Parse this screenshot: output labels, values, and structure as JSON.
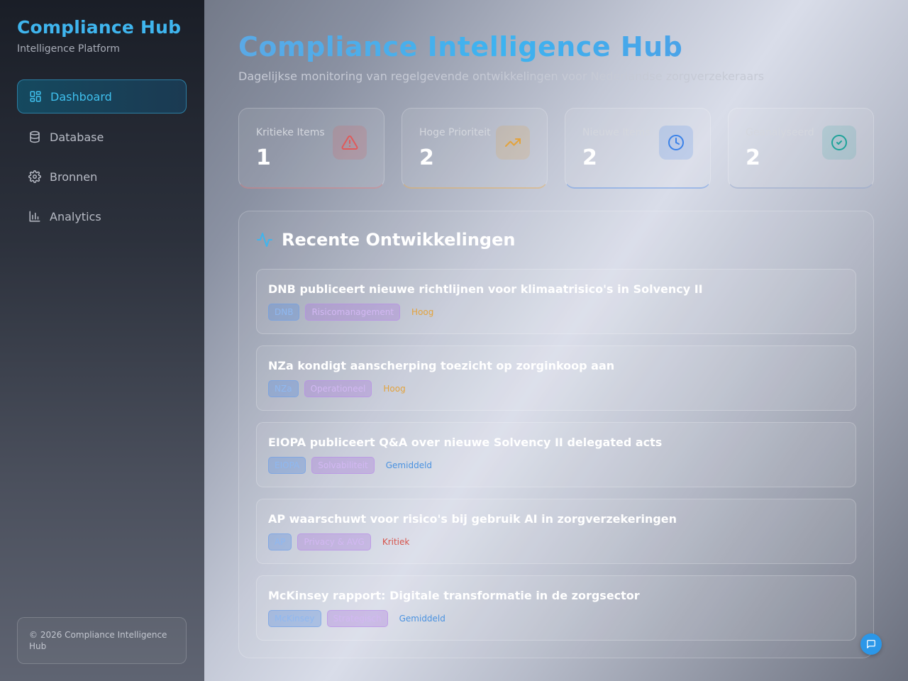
{
  "sidebar": {
    "brand_title": "Compliance Hub",
    "brand_subtitle": "Intelligence Platform",
    "items": [
      {
        "label": "Dashboard",
        "icon": "dashboard-icon",
        "active": true
      },
      {
        "label": "Database",
        "icon": "database-icon",
        "active": false
      },
      {
        "label": "Bronnen",
        "icon": "gear-icon",
        "active": false
      },
      {
        "label": "Analytics",
        "icon": "bar-chart-icon",
        "active": false
      }
    ],
    "footer": "© 2026 Compliance Intelligence Hub"
  },
  "header": {
    "title": "Compliance Intelligence Hub",
    "subtitle": "Dagelijkse monitoring van regelgevende ontwikkelingen voor Nederlandse zorgverzekeraars"
  },
  "stats": [
    {
      "label": "Kritieke Items",
      "value": "1",
      "icon": "alert-triangle-icon",
      "color": "#e05a5a"
    },
    {
      "label": "Hoge Prioriteit",
      "value": "2",
      "icon": "trending-up-icon",
      "color": "#e3a33d"
    },
    {
      "label": "Nieuwe Items",
      "value": "2",
      "icon": "clock-icon",
      "color": "#3b82e8"
    },
    {
      "label": "Geanalyseerd",
      "value": "2",
      "icon": "check-circle-icon",
      "color": "#1fa39a"
    }
  ],
  "recent": {
    "title": "Recente Ontwikkelingen",
    "icon": "activity-icon",
    "items": [
      {
        "title": "DNB publiceert nieuwe richtlijnen voor klimaatrisico's in Solvency II",
        "source": "DNB",
        "category": "Risicomanagement",
        "priority": "Hoog"
      },
      {
        "title": "NZa kondigt aanscherping toezicht op zorginkoop aan",
        "source": "NZa",
        "category": "Operationeel",
        "priority": "Hoog"
      },
      {
        "title": "EIOPA publiceert Q&A over nieuwe Solvency II delegated acts",
        "source": "EIOPA",
        "category": "Solvabiliteit",
        "priority": "Gemiddeld"
      },
      {
        "title": "AP waarschuwt voor risico's bij gebruik AI in zorgverzekeringen",
        "source": "AP",
        "category": "Privacy & AVG",
        "priority": "Kritiek"
      },
      {
        "title": "McKinsey rapport: Digitale transformatie in de zorgsector",
        "source": "McKinsey",
        "category": "Strategisch",
        "priority": "Gemiddeld"
      }
    ]
  },
  "colors": {
    "accent": "#3fb5ee",
    "high": "#e3a33d",
    "medium": "#4a92e0",
    "critical": "#d6544c"
  }
}
